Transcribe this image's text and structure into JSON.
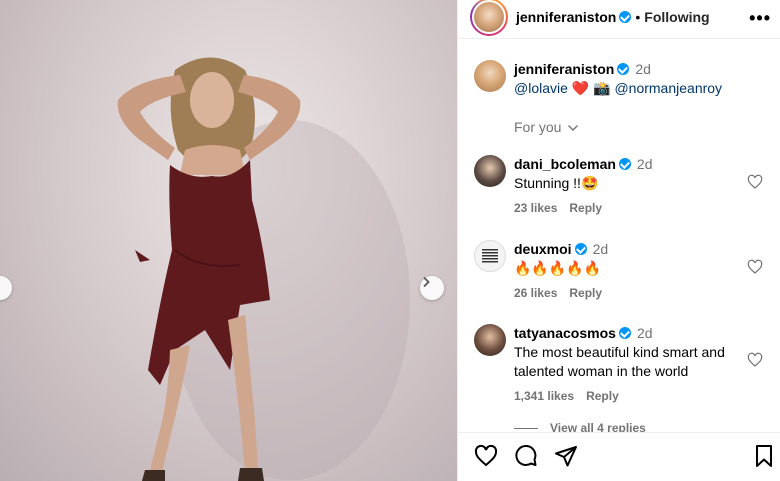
{
  "post": {
    "author": "jenniferaniston",
    "follow_status": "Following",
    "caption": {
      "username": "jenniferaniston",
      "time": "2d",
      "mention1": "@lolavie",
      "mention2": "@normanjeanroy",
      "emoji_heart": "❤️",
      "emoji_camera": "📸"
    },
    "for_you_label": "For you"
  },
  "comments": [
    {
      "username": "dani_bcoleman",
      "time": "2d",
      "text": "Stunning !!🤩",
      "likes": "23 likes",
      "reply": "Reply"
    },
    {
      "username": "deuxmoi",
      "time": "2d",
      "text": "🔥🔥🔥🔥🔥",
      "likes": "26 likes",
      "reply": "Reply"
    },
    {
      "username": "tatyanacosmos",
      "time": "2d",
      "text": "The most beautiful kind smart and talented woman in the world",
      "likes": "1,341 likes",
      "reply": "Reply"
    }
  ],
  "view_replies": "View all 4 replies",
  "icons": {
    "header_more": "more-icon",
    "like": "heart-icon",
    "comment": "comment-icon",
    "share": "send-icon",
    "save": "bookmark-icon",
    "next": "chevron-right-icon",
    "prev": "chevron-left-icon"
  },
  "colors": {
    "verified": "#0095f6",
    "dress": "#5e1a1d",
    "link": "#00376b",
    "muted": "#737373"
  }
}
